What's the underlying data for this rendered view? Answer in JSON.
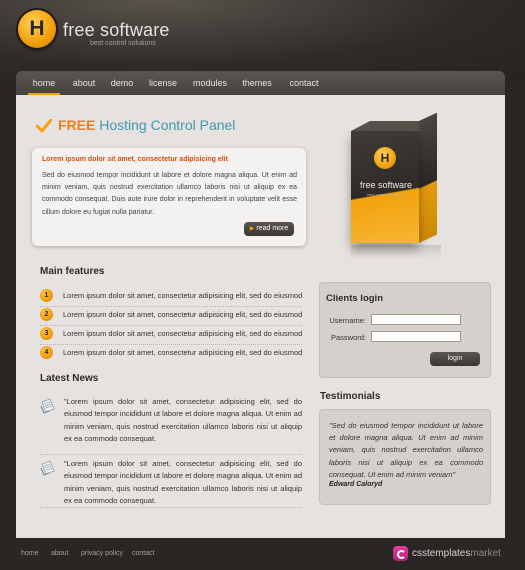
{
  "brand": {
    "logo_letter": "H",
    "title": "free software",
    "tagline": "best control solutions"
  },
  "nav": {
    "items": [
      "home",
      "about",
      "demo",
      "license",
      "modules",
      "themes",
      "contact"
    ],
    "active": "home"
  },
  "hero": {
    "title_emphasis": "FREE",
    "title_rest": "Hosting Control Panel",
    "intro_heading": "Lorem ipsum dolor sit amet, consectetur adipisicing elit",
    "intro_text": "Sed do eiusmod tempor incididunt ut labore et dolore magna aliqua. Ut enim ad minim veniam, quis nostrud exercitation ullamco laboris nisi ut aliquip ex ea commodo consequat. Duis aute irure dolor in reprehenderit in voluptate velit esse cillum dolore eu fugiat nulla pariatur.",
    "read_more": "read more"
  },
  "product_box": {
    "logo_letter": "H",
    "name": "free software",
    "subtitle": "best control solutions"
  },
  "features": {
    "title": "Main features",
    "items": [
      {
        "number": "1",
        "text": "Lorem ipsum dolor sit amet, consectetur adipisicing elit, sed do eiusmod"
      },
      {
        "number": "2",
        "text": "Lorem ipsum dolor sit amet, consectetur adipisicing elit, sed do eiusmod"
      },
      {
        "number": "3",
        "text": "Lorem ipsum dolor sit amet, consectetur adipisicing elit, sed do eiusmod"
      },
      {
        "number": "4",
        "text": "Lorem ipsum dolor sit amet, consectetur adipisicing elit, sed do eiusmod"
      }
    ]
  },
  "news": {
    "title": "Latest News",
    "items": [
      {
        "text": "\"Lorem ipsum dolor sit amet, consectetur adipisicing elit, sed do eiusmod tempor incididunt ut labore et dolore magna aliqua. Ut enim ad minim veniam, quis nostrud exercitation ullamco laboris nisi ut aliquip ex ea commodo consequat."
      },
      {
        "text": "\"Lorem ipsum dolor sit amet, consectetur adipisicing elit, sed do eiusmod tempor incididunt ut labore et dolore magna aliqua. Ut enim ad minim veniam, quis nostrud exercitation ullamco laboris nisi ut aliquip ex ea commodo consequat."
      }
    ]
  },
  "login": {
    "title": "Clients login",
    "username_label": "Username:",
    "username_value": "",
    "password_label": "Password:",
    "password_value": "",
    "button": "login"
  },
  "testimonials": {
    "title": "Testimonials",
    "quote": "\"Sed do eiusmod tempor incididunt ut labore et dolore magna aliqua. Ut enim ad minim veniam, quis nostrud exercitation ullamco laboris nisi ut aliquip ex ea commodo consequat. Ut enim ad minim veniam\"",
    "author": "Edward Caloryd"
  },
  "footer": {
    "links": [
      "home",
      "about",
      "privacy policy",
      "contact"
    ],
    "market_bold": "csstemplates",
    "market_thin": "market"
  },
  "colors": {
    "accent_orange": "#f2a20c",
    "heading_orange": "#e87e1c",
    "heading_blue": "#3f97b2",
    "intro_heading_red": "#d64f0e"
  }
}
